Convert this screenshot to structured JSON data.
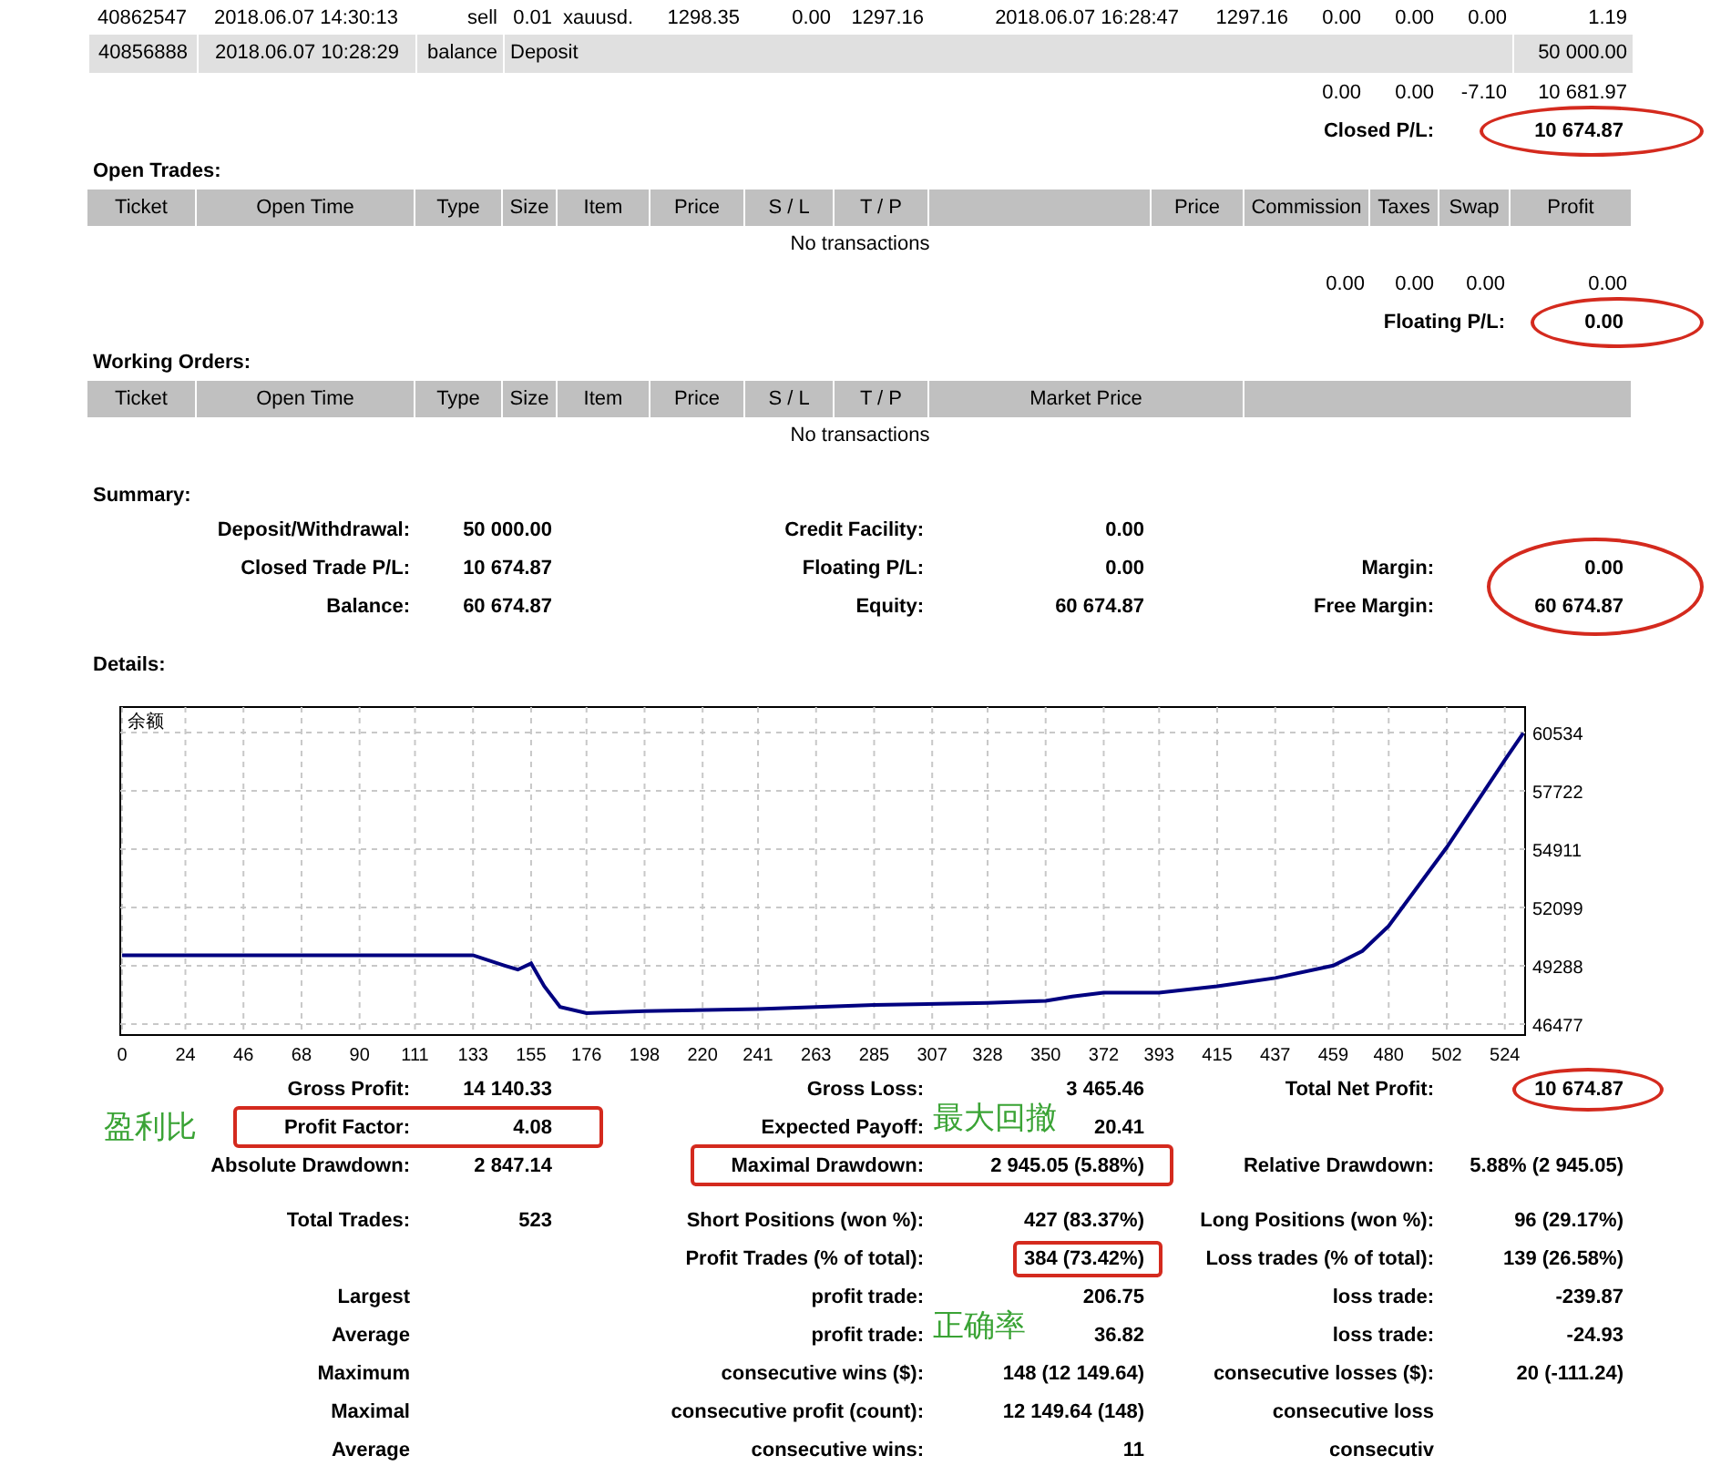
{
  "closed_trades": {
    "rows": [
      {
        "kind": "trade",
        "cells": [
          "40862547",
          "2018.06.07 14:30:13",
          "sell",
          "0.01",
          "xauusd.",
          "1298.35",
          "0.00",
          "1297.16",
          "2018.06.07 16:28:47",
          "1297.16",
          "0.00",
          "0.00",
          "0.00",
          "1.19"
        ]
      },
      {
        "kind": "balance",
        "ticket": "40856888",
        "time": "2018.06.07 10:28:29",
        "type": "balance",
        "comment": "Deposit",
        "profit": "50 000.00"
      }
    ],
    "totals": [
      "0.00",
      "0.00",
      "-7.10",
      "10 681.97"
    ],
    "result": {
      "label": "Closed P/L:",
      "value": "10 674.87",
      "circled": true
    }
  },
  "open_trades": {
    "title": "Open Trades:",
    "columns": [
      "Ticket",
      "Open Time",
      "Type",
      "Size",
      "Item",
      "Price",
      "S / L",
      "T / P",
      "Price",
      "Commission",
      "Taxes",
      "Swap",
      "Profit"
    ],
    "empty": "No transactions",
    "totals": [
      "0.00",
      "0.00",
      "0.00",
      "0.00"
    ],
    "result": {
      "label": "Floating P/L:",
      "value": "0.00",
      "circled": true
    }
  },
  "working_orders": {
    "title": "Working Orders:",
    "columns": [
      "Ticket",
      "Open Time",
      "Type",
      "Size",
      "Item",
      "Price",
      "S / L",
      "T / P",
      "Market Price"
    ],
    "empty": "No transactions"
  },
  "summary": {
    "title": "Summary:",
    "rows": [
      {
        "left": {
          "label": "Deposit/Withdrawal:",
          "value": "50 000.00"
        },
        "middle": {
          "label": "Credit Facility:",
          "value": "0.00"
        }
      },
      {
        "left": {
          "label": "Closed Trade P/L:",
          "value": "10 674.87"
        },
        "middle": {
          "label": "Floating P/L:",
          "value": "0.00"
        },
        "right": {
          "label": "Margin:",
          "value": "0.00"
        }
      },
      {
        "left": {
          "label": "Balance:",
          "value": "60 674.87"
        },
        "middle": {
          "label": "Equity:",
          "value": "60 674.87"
        },
        "right": {
          "label": "Free Margin:",
          "value": "60 674.87",
          "circled": true
        }
      }
    ]
  },
  "details": {
    "title": "Details:",
    "chart_data": {
      "type": "line",
      "title": "余额",
      "grid": true,
      "xlim": [
        0,
        531
      ],
      "ylim": [
        45950,
        61760
      ],
      "xticks": [
        0,
        24,
        46,
        68,
        90,
        111,
        133,
        155,
        176,
        198,
        220,
        241,
        263,
        285,
        307,
        328,
        350,
        372,
        393,
        415,
        437,
        459,
        480,
        502,
        524
      ],
      "yticks": [
        46477,
        49288,
        52099,
        54911,
        57722,
        60534
      ],
      "x": [
        0,
        24,
        46,
        68,
        90,
        111,
        133,
        145,
        150,
        155,
        160,
        166,
        176,
        198,
        241,
        285,
        328,
        350,
        360,
        372,
        393,
        415,
        437,
        459,
        470,
        480,
        502,
        524,
        531
      ],
      "series": [
        {
          "color": "#000080",
          "values": [
            49800,
            49800,
            49800,
            49800,
            49800,
            49800,
            49800,
            49300,
            49100,
            49400,
            48300,
            47300,
            47000,
            47100,
            47200,
            47400,
            47500,
            47600,
            47800,
            48000,
            48000,
            48300,
            48700,
            49300,
            50000,
            51200,
            55000,
            59200,
            60500
          ]
        }
      ]
    }
  },
  "statistics": {
    "groups": [
      [
        {
          "left": {
            "label": "Gross Profit:",
            "value": "14 140.33"
          },
          "middle": {
            "label": "Gross Loss:",
            "value": "3 465.46"
          },
          "right": {
            "label": "Total Net Profit:",
            "value": "10 674.87",
            "circled": true
          }
        },
        {
          "left": {
            "label": "Profit Factor:",
            "value": "4.08",
            "boxed": true,
            "note": "盈利比"
          },
          "middle": {
            "label": "Expected Payoff:",
            "value": "20.41",
            "note": "最大回撤"
          }
        },
        {
          "left": {
            "label": "Absolute Drawdown:",
            "value": "2 847.14"
          },
          "middle": {
            "label": "Maximal Drawdown:",
            "value": "2 945.05 (5.88%)",
            "boxed": true
          },
          "right": {
            "label": "Relative Drawdown:",
            "value": "5.88% (2 945.05)"
          }
        }
      ],
      [
        {
          "left": {
            "label": "Total Trades:",
            "value": "523"
          },
          "middle": {
            "label": "Short Positions (won %):",
            "value": "427 (83.37%)"
          },
          "right": {
            "label": "Long Positions (won %):",
            "value": "96 (29.17%)"
          }
        },
        {
          "middle": {
            "label": "Profit Trades (% of total):",
            "value": "384 (73.42%)",
            "value_boxed": true
          },
          "right": {
            "label": "Loss trades (% of total):",
            "value": "139 (26.58%)"
          }
        },
        {
          "left": {
            "label": "Largest"
          },
          "middle": {
            "label": "profit trade:",
            "value": "206.75"
          },
          "right": {
            "label": "loss trade:",
            "value": "-239.87"
          }
        },
        {
          "left": {
            "label": "Average"
          },
          "middle": {
            "label": "profit trade:",
            "value": "36.82",
            "note": "正确率"
          },
          "right": {
            "label": "loss trade:",
            "value": "-24.93"
          }
        },
        {
          "left": {
            "label": "Maximum"
          },
          "middle": {
            "label": "consecutive wins ($):",
            "value": "148 (12 149.64)"
          },
          "right": {
            "label": "consecutive losses ($):",
            "value": "20 (-111.24)"
          }
        },
        {
          "left": {
            "label": "Maximal"
          },
          "middle": {
            "label": "consecutive profit (count):",
            "value": "12 149.64 (148)"
          },
          "right": {
            "label": "consecutive loss"
          }
        },
        {
          "left": {
            "label": "Average"
          },
          "middle": {
            "label": "consecutive wins:",
            "value": "11"
          },
          "right": {
            "label": "consecutiv"
          }
        }
      ]
    ]
  }
}
